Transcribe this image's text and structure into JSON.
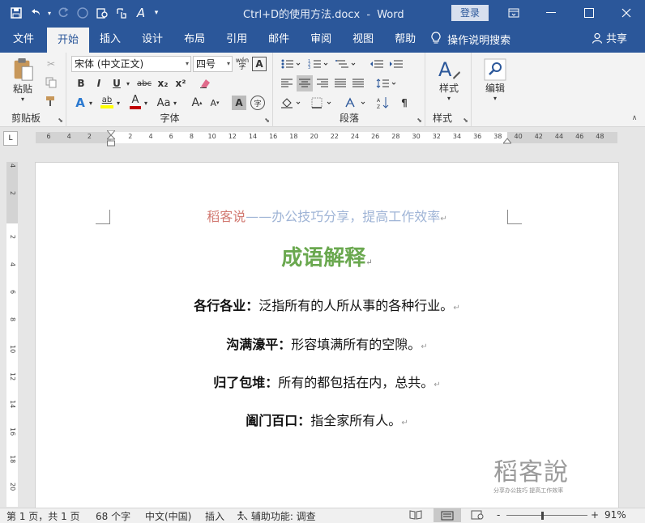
{
  "window": {
    "doc_title": "Ctrl+D的使用方法.docx",
    "app_sep": "-",
    "app_name": "Word",
    "login": "登录"
  },
  "qat": {
    "icons": [
      "save-icon",
      "undo-icon",
      "redo-icon",
      "circle-icon",
      "print-preview-icon",
      "touch-mode-icon",
      "font-style-icon",
      "customize-icon"
    ]
  },
  "tabs": [
    "文件",
    "开始",
    "插入",
    "设计",
    "布局",
    "引用",
    "邮件",
    "审阅",
    "视图",
    "帮助"
  ],
  "active_tab": "开始",
  "tellme": "操作说明搜索",
  "share": "共享",
  "ribbon": {
    "clipboard": {
      "label": "剪贴板",
      "paste": "粘贴"
    },
    "font": {
      "label": "字体",
      "font_name": "宋体 (中文正文)",
      "font_size": "四号",
      "bold": "B",
      "italic": "I",
      "underline": "U",
      "strike": "abc",
      "subscript": "x₂",
      "superscript": "x²",
      "text_effect": "A",
      "highlight": "ab",
      "font_color": "A",
      "change_case": "Aa",
      "grow": "A",
      "shrink": "A",
      "char_shading": "A",
      "enclose": "字",
      "phonetic": "wén",
      "border_char": "A"
    },
    "paragraph": {
      "label": "段落"
    },
    "styles": {
      "label": "样式",
      "btn": "样式"
    },
    "editing": {
      "btn": "编辑"
    }
  },
  "ruler": {
    "h_ticks": [
      "6",
      "4",
      "2",
      "2",
      "4",
      "6",
      "8",
      "10",
      "12",
      "14",
      "16",
      "18",
      "20",
      "22",
      "24",
      "26",
      "28",
      "30",
      "32",
      "34",
      "36",
      "38",
      "40",
      "42",
      "44",
      "46",
      "48"
    ],
    "v_ticks": [
      "4",
      "2",
      "2",
      "4",
      "6",
      "8",
      "10",
      "12",
      "14",
      "16",
      "18",
      "20"
    ]
  },
  "document": {
    "header_brand": "稻客说",
    "header_rest": "——办公技巧分享，提高工作效率",
    "title": "成语解释",
    "idioms": [
      {
        "term": "各行各业：",
        "def": "泛指所有的人所从事的各种行业。"
      },
      {
        "term": "沟满濠平：",
        "def": "形容填满所有的空隙。"
      },
      {
        "term": "归了包堆：",
        "def": "所有的都包括在内，总共。"
      },
      {
        "term": "阖门百口：",
        "def": "指全家所有人。"
      }
    ],
    "para_mark": "↵",
    "watermark": {
      "main": "稻客說",
      "sub": "分享办公技巧 提高工作效率"
    }
  },
  "status": {
    "page": "第 1 页，共 1 页",
    "words": "68 个字",
    "lang": "中文(中国)",
    "mode": "插入",
    "access": "辅助功能: 调查",
    "zoom": "91%",
    "zoom_minus": "-",
    "zoom_plus": "+"
  },
  "colors": {
    "accent": "#2b579a",
    "title_green": "#6aa84f",
    "header_brand": "#d27a72",
    "header_rest": "#9fb4d6"
  }
}
